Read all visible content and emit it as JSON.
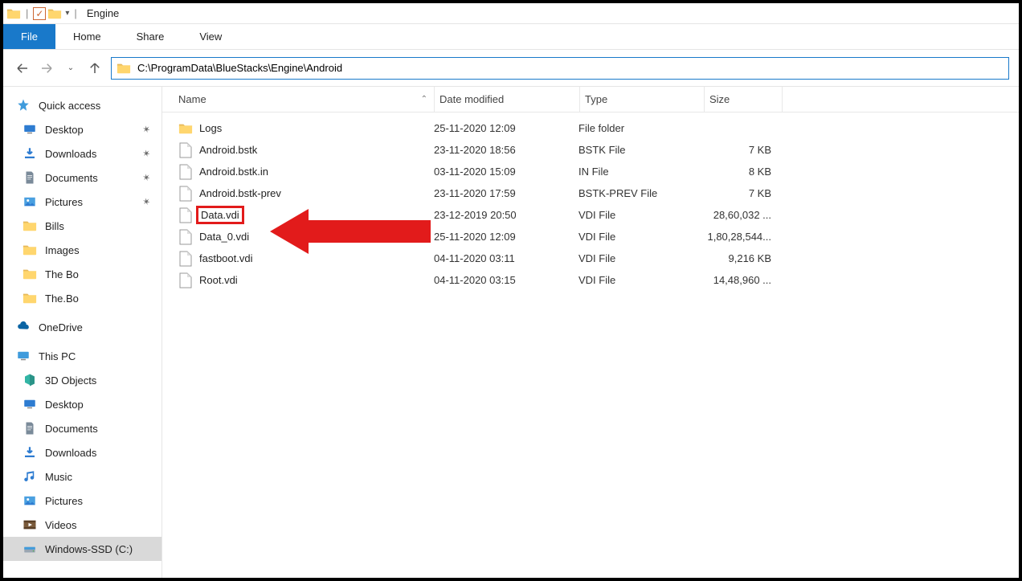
{
  "window": {
    "title": "Engine"
  },
  "menu": {
    "file": "File",
    "home": "Home",
    "share": "Share",
    "view": "View"
  },
  "address": {
    "path": "C:\\ProgramData\\BlueStacks\\Engine\\Android"
  },
  "sidebar": {
    "quick_access": "Quick access",
    "qa_items": [
      {
        "label": "Desktop",
        "pinned": true,
        "icon": "desktop"
      },
      {
        "label": "Downloads",
        "pinned": true,
        "icon": "downloads"
      },
      {
        "label": "Documents",
        "pinned": true,
        "icon": "documents"
      },
      {
        "label": "Pictures",
        "pinned": true,
        "icon": "pictures"
      },
      {
        "label": "Bills",
        "pinned": false,
        "icon": "folder"
      },
      {
        "label": "Images",
        "pinned": false,
        "icon": "folder"
      },
      {
        "label": "The Bo",
        "pinned": false,
        "icon": "folder"
      },
      {
        "label": "The.Bo",
        "pinned": false,
        "icon": "folder"
      }
    ],
    "onedrive": "OneDrive",
    "this_pc": "This PC",
    "pc_items": [
      {
        "label": "3D Objects",
        "icon": "3d"
      },
      {
        "label": "Desktop",
        "icon": "desktop"
      },
      {
        "label": "Documents",
        "icon": "documents"
      },
      {
        "label": "Downloads",
        "icon": "downloads"
      },
      {
        "label": "Music",
        "icon": "music"
      },
      {
        "label": "Pictures",
        "icon": "pictures"
      },
      {
        "label": "Videos",
        "icon": "videos"
      },
      {
        "label": "Windows-SSD (C:)",
        "icon": "drive",
        "selected": true
      }
    ]
  },
  "columns": {
    "name": "Name",
    "date": "Date modified",
    "type": "Type",
    "size": "Size"
  },
  "files": [
    {
      "name": "Logs",
      "date": "25-11-2020 12:09",
      "type": "File folder",
      "size": "",
      "icon": "folder"
    },
    {
      "name": "Android.bstk",
      "date": "23-11-2020 18:56",
      "type": "BSTK File",
      "size": "7 KB",
      "icon": "file"
    },
    {
      "name": "Android.bstk.in",
      "date": "03-11-2020 15:09",
      "type": "IN File",
      "size": "8 KB",
      "icon": "file"
    },
    {
      "name": "Android.bstk-prev",
      "date": "23-11-2020 17:59",
      "type": "BSTK-PREV File",
      "size": "7 KB",
      "icon": "file"
    },
    {
      "name": "Data.vdi",
      "date": "23-12-2019 20:50",
      "type": "VDI File",
      "size": "28,60,032 ...",
      "icon": "file",
      "highlight": true
    },
    {
      "name": "Data_0.vdi",
      "date": "25-11-2020 12:09",
      "type": "VDI File",
      "size": "1,80,28,544...",
      "icon": "file"
    },
    {
      "name": "fastboot.vdi",
      "date": "04-11-2020 03:11",
      "type": "VDI File",
      "size": "9,216 KB",
      "icon": "file"
    },
    {
      "name": "Root.vdi",
      "date": "04-11-2020 03:15",
      "type": "VDI File",
      "size": "14,48,960 ...",
      "icon": "file"
    }
  ]
}
